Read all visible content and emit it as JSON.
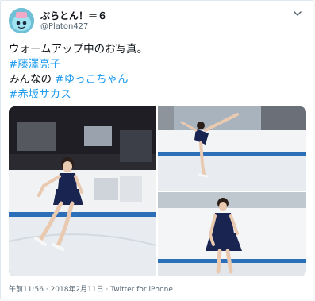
{
  "tweet": {
    "display_name": "ぷらとん！＝６",
    "handle": "@Platon427",
    "text_line1": "ウォームアップ中のお写真。",
    "hashtag1": "#藤澤亮子",
    "text_line3_prefix": "みんなの ",
    "hashtag2": "#ゆっこちゃん",
    "hashtag3": "#赤坂サカス"
  },
  "media": {
    "photo_count": 3
  },
  "meta": {
    "time": "午前11:56",
    "separator": " · ",
    "date": "2018年2月11日",
    "source": "Twitter for iPhone"
  },
  "colors": {
    "hashtag": "#1d9bf0",
    "secondary_text": "#536471",
    "avatar_bg": "#6fbfd6",
    "ice": "#e8ecf0",
    "rink_blue": "#2b6fb8",
    "costume": "#1a2450"
  },
  "icons": {
    "more": "more-options-icon",
    "avatar": "avatar-icon"
  }
}
